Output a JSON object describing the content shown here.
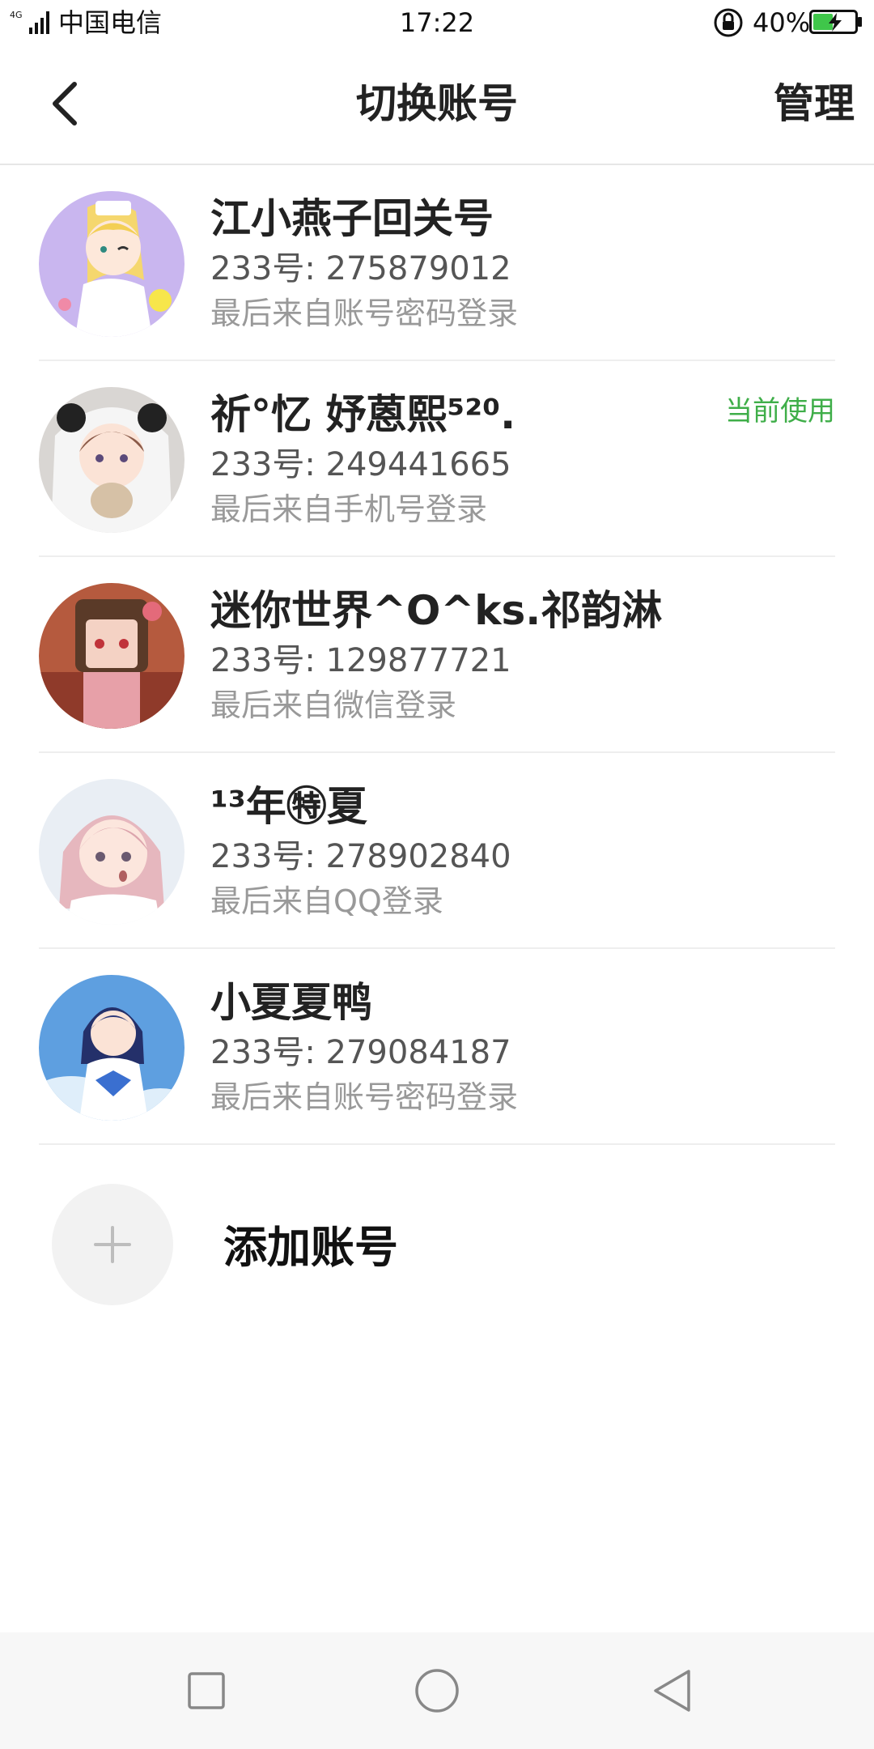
{
  "status_bar": {
    "network": "4G",
    "carrier": "中国电信",
    "time": "17:22",
    "battery": "40%"
  },
  "header": {
    "title": "切换账号",
    "manage": "管理"
  },
  "accounts": [
    {
      "name": "江小燕子回关号",
      "id": "233号: 275879012",
      "login": "最后来自账号密码登录",
      "current": ""
    },
    {
      "name": "祈°忆 妤蒽熙⁵²⁰.",
      "id": "233号: 249441665",
      "login": "最后来自手机号登录",
      "current": "当前使用"
    },
    {
      "name": "迷你世界^O^ks.祁韵淋",
      "id": "233号: 129877721",
      "login": "最后来自微信登录",
      "current": ""
    },
    {
      "name": "¹³年㊕夏",
      "id": "233号: 278902840",
      "login": "最后来自QQ登录",
      "current": ""
    },
    {
      "name": "小夏夏鸭",
      "id": "233号: 279084187",
      "login": "最后来自账号密码登录",
      "current": ""
    }
  ],
  "add_account": {
    "label": "添加账号"
  },
  "colors": {
    "accent_green": "#3fae49",
    "divider": "#eeeeee",
    "nav_bar_bg": "#f7f7f7"
  }
}
